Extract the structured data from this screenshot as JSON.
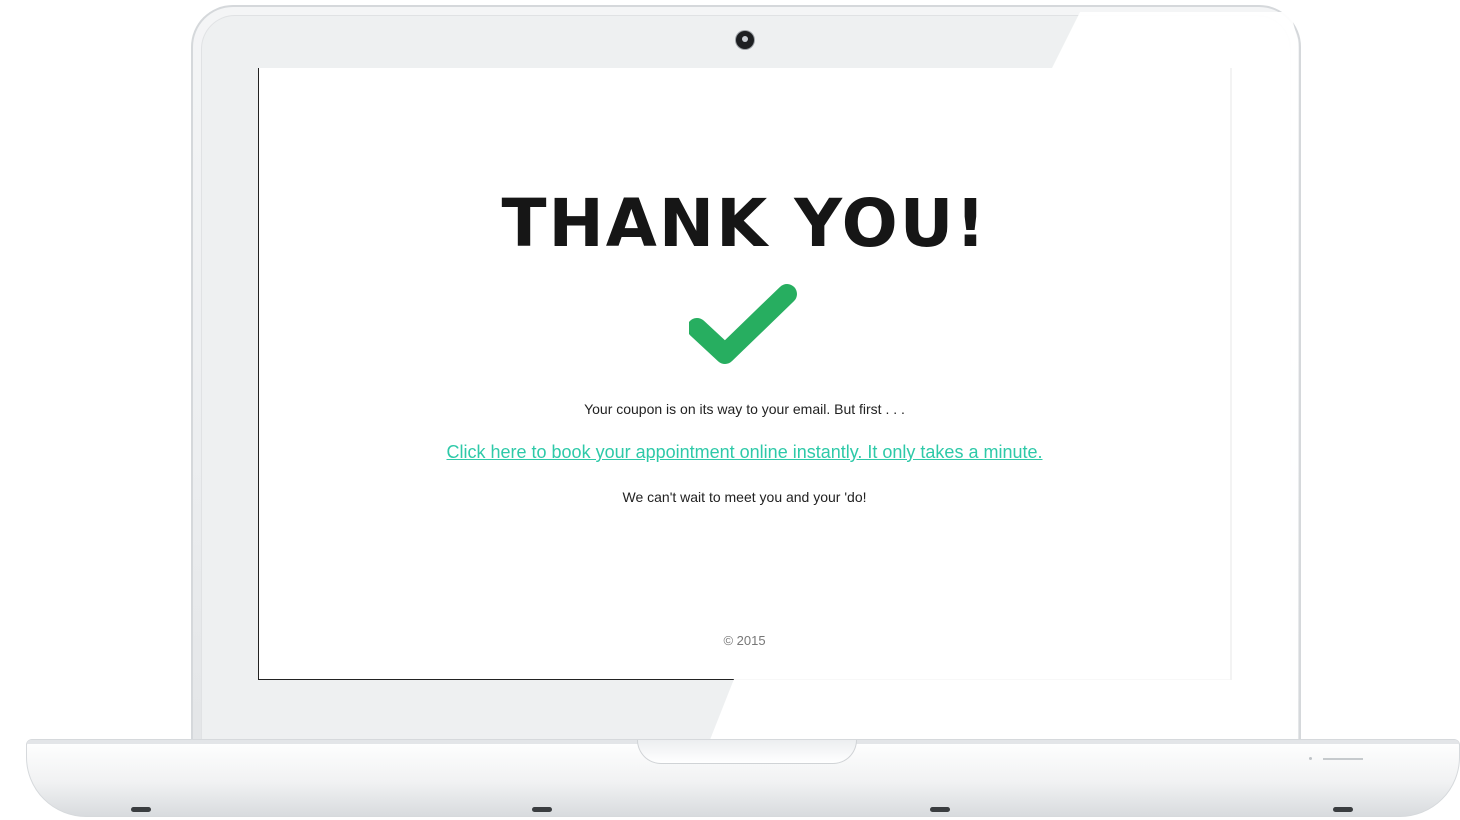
{
  "screen": {
    "heading": "THANK YOU!",
    "check_icon": "check-icon",
    "message": "Your coupon is on its way to your email. But first . . .",
    "booking_link_text": "Click here to book your appointment online instantly. It only takes a minute.",
    "closing_message": "We can't wait to meet you and your 'do!",
    "footer": "© 2015"
  },
  "colors": {
    "check": "#27ae60",
    "link": "#2ec9a8",
    "heading": "#161616"
  }
}
